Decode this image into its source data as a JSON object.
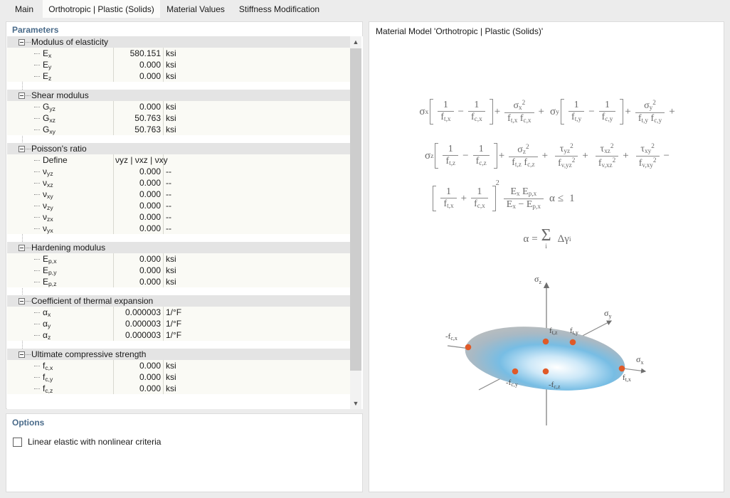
{
  "tabs": [
    {
      "label": "Main",
      "active": false
    },
    {
      "label": "Orthotropic | Plastic (Solids)",
      "active": true
    },
    {
      "label": "Material Values",
      "active": false
    },
    {
      "label": "Stiffness Modification",
      "active": false
    }
  ],
  "left_panel": {
    "section_title": "Parameters",
    "groups": [
      {
        "name": "Modulus of elasticity",
        "rows": [
          {
            "label_base": "E",
            "label_sub": "x",
            "value": "580.151",
            "unit": "ksi"
          },
          {
            "label_base": "E",
            "label_sub": "y",
            "value": "0.000",
            "unit": "ksi"
          },
          {
            "label_base": "E",
            "label_sub": "z",
            "value": "0.000",
            "unit": "ksi"
          }
        ]
      },
      {
        "name": "Shear modulus",
        "rows": [
          {
            "label_base": "G",
            "label_sub": "yz",
            "value": "0.000",
            "unit": "ksi"
          },
          {
            "label_base": "G",
            "label_sub": "xz",
            "value": "50.763",
            "unit": "ksi"
          },
          {
            "label_base": "G",
            "label_sub": "xy",
            "value": "50.763",
            "unit": "ksi"
          }
        ]
      },
      {
        "name": "Poisson's ratio",
        "rows": [
          {
            "label_base": "Define",
            "label_sub": "",
            "value": "νyz | νxz | νxy",
            "unit": "",
            "value_align": "left"
          },
          {
            "label_base": "ν",
            "label_sub": "yz",
            "value": "0.000",
            "unit": "--"
          },
          {
            "label_base": "ν",
            "label_sub": "xz",
            "value": "0.000",
            "unit": "--"
          },
          {
            "label_base": "ν",
            "label_sub": "xy",
            "value": "0.000",
            "unit": "--"
          },
          {
            "label_base": "ν",
            "label_sub": "zy",
            "value": "0.000",
            "unit": "--"
          },
          {
            "label_base": "ν",
            "label_sub": "zx",
            "value": "0.000",
            "unit": "--"
          },
          {
            "label_base": "ν",
            "label_sub": "yx",
            "value": "0.000",
            "unit": "--"
          }
        ]
      },
      {
        "name": "Hardening modulus",
        "rows": [
          {
            "label_base": "E",
            "label_sub": "p,x",
            "value": "0.000",
            "unit": "ksi"
          },
          {
            "label_base": "E",
            "label_sub": "p,y",
            "value": "0.000",
            "unit": "ksi"
          },
          {
            "label_base": "E",
            "label_sub": "p,z",
            "value": "0.000",
            "unit": "ksi"
          }
        ]
      },
      {
        "name": "Coefficient of thermal expansion",
        "rows": [
          {
            "label_base": "α",
            "label_sub": "x",
            "value": "0.000003",
            "unit": "1/°F"
          },
          {
            "label_base": "α",
            "label_sub": "y",
            "value": "0.000003",
            "unit": "1/°F"
          },
          {
            "label_base": "α",
            "label_sub": "z",
            "value": "0.000003",
            "unit": "1/°F"
          }
        ]
      },
      {
        "name": "Ultimate compressive strength",
        "rows": [
          {
            "label_base": "f",
            "label_sub": "c,x",
            "value": "0.000",
            "unit": "ksi"
          },
          {
            "label_base": "f",
            "label_sub": "c,y",
            "value": "0.000",
            "unit": "ksi"
          },
          {
            "label_base": "f",
            "label_sub": "c,z",
            "value": "0.000",
            "unit": "ksi"
          }
        ]
      }
    ],
    "scroll_up_icon": "chevron-up-icon",
    "scroll_down_icon": "chevron-down-icon"
  },
  "options_panel": {
    "section_title": "Options",
    "checkbox_label": "Linear elastic with nonlinear criteria",
    "checkbox_checked": false
  },
  "right_panel": {
    "title": "Material Model 'Orthotropic | Plastic (Solids)'",
    "formula_lines": [
      "σx [ 1/ft,x − 1/fc,x ] + σx²/(ft,x fc,x) + σy [ 1/ft,y − 1/fc,y ] + σy²/(ft,y fc,y) +",
      "σz [ 1/ft,z − 1/fc,z ] + σz²/(ft,z fc,z) + τyz²/fv,yz² + τxz²/fv,xz² + τxy²/fv,xy² −",
      "[ 1/ft,x + 1/fc,x ]² (Ex Ep,x)/(Ex − Ep,x) α ≤ 1",
      "α = Σi Δγi"
    ],
    "diagram": {
      "title": "orthotropic-plastic-yield-ellipsoid",
      "axes": [
        "σz",
        "σy",
        "σx"
      ],
      "point_labels": [
        "-fc,x",
        "ft,z",
        "ft,y",
        "σx",
        "ft,x",
        "-fc,y",
        "-fc,z"
      ],
      "point_color": "#e05a28",
      "surface_color": "#69b4e0"
    }
  },
  "colors": {
    "window_bg": "#ececec",
    "panel_bg": "#ffffff",
    "group_header_bg": "#e4e4e4",
    "row_bg": "#fafaf5",
    "section_title": "#4a6b8a",
    "scrollbar_thumb": "#cdcdcd",
    "formula_text": "#6b6b6b"
  }
}
